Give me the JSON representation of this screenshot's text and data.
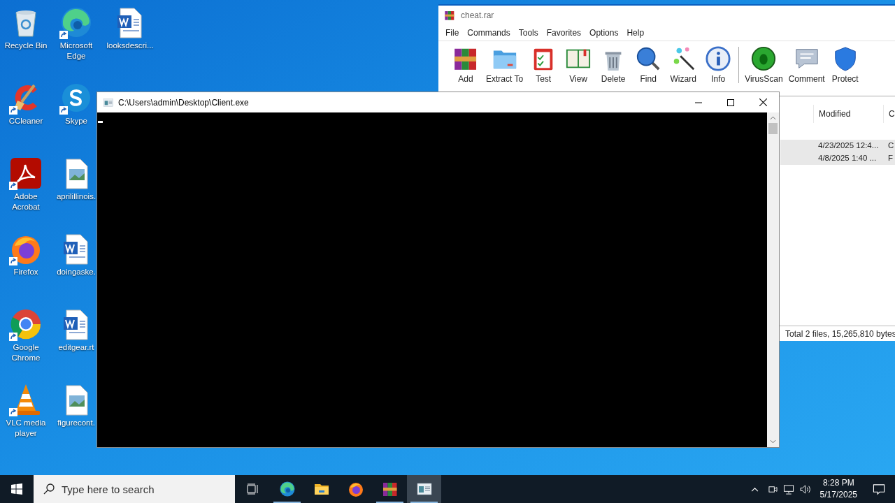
{
  "desktop": {
    "columns": [
      [
        {
          "label": "Recycle Bin",
          "kind": "recycle",
          "shortcut": false
        },
        {
          "label": "CCleaner",
          "kind": "ccleaner",
          "shortcut": true
        },
        {
          "label": "Adobe Acrobat",
          "kind": "acrobat",
          "shortcut": true
        },
        {
          "label": "Firefox",
          "kind": "firefox",
          "shortcut": true
        },
        {
          "label": "Google Chrome",
          "kind": "chrome",
          "shortcut": true
        },
        {
          "label": "VLC media player",
          "kind": "vlc",
          "shortcut": true
        }
      ],
      [
        {
          "label": "Microsoft Edge",
          "kind": "edge",
          "shortcut": true
        },
        {
          "label": "Skype",
          "kind": "skype",
          "shortcut": true
        },
        {
          "label": "aprilillinois.",
          "kind": "image",
          "shortcut": false
        },
        {
          "label": "doingaske.",
          "kind": "word",
          "shortcut": false
        },
        {
          "label": "editgear.rt",
          "kind": "word",
          "shortcut": false
        },
        {
          "label": "figurecont.",
          "kind": "image",
          "shortcut": false
        }
      ],
      [
        {
          "label": "looksdescri...",
          "kind": "word",
          "shortcut": false
        }
      ]
    ]
  },
  "archive_window": {
    "title": "cheat.rar",
    "menu": [
      "File",
      "Commands",
      "Tools",
      "Favorites",
      "Options",
      "Help"
    ],
    "toolbar": [
      {
        "label": "Add",
        "kind": "add"
      },
      {
        "label": "Extract To",
        "kind": "extract"
      },
      {
        "label": "Test",
        "kind": "test"
      },
      {
        "label": "View",
        "kind": "view"
      },
      {
        "label": "Delete",
        "kind": "delete"
      },
      {
        "label": "Find",
        "kind": "find"
      },
      {
        "label": "Wizard",
        "kind": "wizard"
      },
      {
        "label": "Info",
        "kind": "info"
      },
      {
        "label": "VirusScan",
        "kind": "virus",
        "separator_before": true
      },
      {
        "label": "Comment",
        "kind": "comment"
      },
      {
        "label": "Protect",
        "kind": "protect"
      }
    ],
    "columns": [
      "Modified",
      "C"
    ],
    "rows": [
      {
        "cells": [
          "4/23/2025 12:4...",
          "C"
        ],
        "selected": true
      },
      {
        "cells": [
          "4/8/2025 1:40 ...",
          "F"
        ],
        "selected": true
      }
    ],
    "status_bar": "Total 2 files, 15,265,810 bytes"
  },
  "console_window": {
    "title": "C:\\Users\\admin\\Desktop\\Client.exe"
  },
  "taskbar": {
    "search": {
      "placeholder": "Type here to search"
    },
    "apps": [
      {
        "kind": "edge",
        "running": true,
        "selected": false
      },
      {
        "kind": "explorer",
        "running": false,
        "selected": false
      },
      {
        "kind": "firefox",
        "running": false,
        "selected": false
      },
      {
        "kind": "winrar",
        "running": true,
        "selected": false
      },
      {
        "kind": "console",
        "running": true,
        "selected": true
      }
    ],
    "time": "8:28 PM",
    "date": "5/17/2025"
  }
}
